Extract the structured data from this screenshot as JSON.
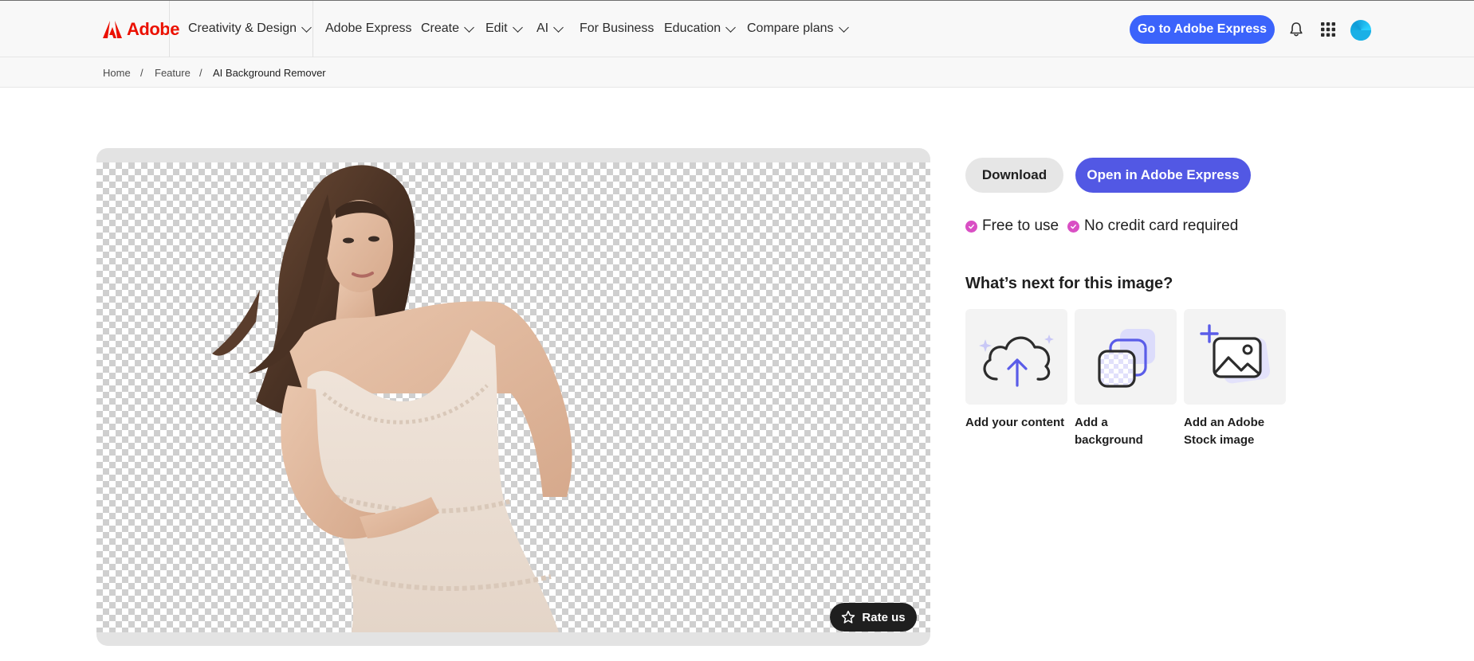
{
  "brand": {
    "name": "Adobe",
    "color": "#eb1000"
  },
  "nav": {
    "items": [
      {
        "label": "Creativity & Design",
        "dropdown": true
      },
      {
        "label": "Adobe Express",
        "dropdown": false
      },
      {
        "label": "Create",
        "dropdown": true
      },
      {
        "label": "Edit",
        "dropdown": true
      },
      {
        "label": "AI",
        "dropdown": true
      },
      {
        "label": "For Business",
        "dropdown": false
      },
      {
        "label": "Education",
        "dropdown": true
      },
      {
        "label": "Compare plans",
        "dropdown": true
      }
    ],
    "cta_label": "Go to Adobe Express",
    "icons": [
      "bell-icon",
      "app-grid-icon",
      "avatar"
    ]
  },
  "breadcrumb": {
    "items": [
      "Home",
      "Feature",
      "AI Background Remover"
    ],
    "separator": "/"
  },
  "preview": {
    "rate_label": "Rate us",
    "background": "transparent-checkerboard"
  },
  "actions": {
    "download_label": "Download",
    "open_label": "Open in Adobe Express"
  },
  "features": [
    "Free to use",
    "No credit card required"
  ],
  "next": {
    "heading": "What’s next for this image?",
    "cards": [
      {
        "label": "Add your content",
        "icon": "cloud-upload-icon"
      },
      {
        "label": "Add a background",
        "icon": "layers-background-icon"
      },
      {
        "label": "Add an Adobe Stock image",
        "icon": "add-image-icon"
      }
    ]
  },
  "colors": {
    "cta_blue": "#3b63fb",
    "open_purple": "#5258e4",
    "check_pink": "#d94fc4",
    "icon_violet": "#5a5ce8"
  }
}
